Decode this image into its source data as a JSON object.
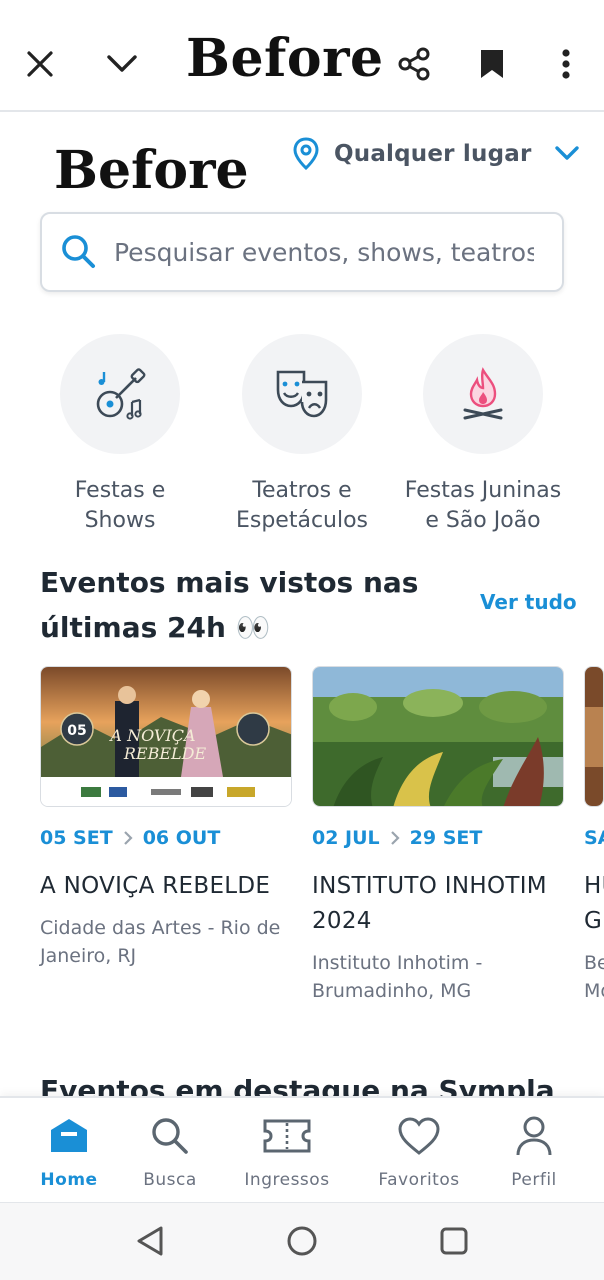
{
  "topbar": {
    "title": "Before"
  },
  "page_heading": "Before",
  "location": {
    "label": "Qualquer lugar"
  },
  "search": {
    "placeholder": "Pesquisar eventos, shows, teatros, festas..."
  },
  "categories": [
    {
      "label_line1": "Festas e",
      "label_line2": "Shows",
      "icon": "guitar-music-icon"
    },
    {
      "label_line1": "Teatros e",
      "label_line2": "Espetáculos",
      "icon": "theater-masks-icon"
    },
    {
      "label_line1": "Festas Juninas",
      "label_line2": "e São João",
      "icon": "bonfire-icon"
    }
  ],
  "section": {
    "title_line1": "Eventos mais vistos nas",
    "title_line2": "últimas 24h 👀",
    "see_all": "Ver tudo"
  },
  "events": [
    {
      "start": "05 SET",
      "end": "06 OUT",
      "title": "A NOVIÇA REBELDE",
      "place": "Cidade das Artes - Rio de Janeiro, RJ",
      "poster_text_1": "A NOVIÇA",
      "poster_text_2": "REBELDE",
      "poster_date": "05"
    },
    {
      "start": "02 JUL",
      "end": "29 SET",
      "title": "INSTITUTO INHOTIM 2024",
      "place": "Instituto Inhotim - Brumadinho, MG"
    },
    {
      "start": "SA",
      "title_line1": "HU",
      "title_line2": "GI",
      "place_line1": "Be",
      "place_line2": "Mo"
    }
  ],
  "next_section": {
    "title": "Eventos em destaque na Sympla"
  },
  "bottom_nav": [
    {
      "label": "Home",
      "active": true
    },
    {
      "label": "Busca"
    },
    {
      "label": "Ingressos"
    },
    {
      "label": "Favoritos"
    },
    {
      "label": "Perfil"
    }
  ],
  "colors": {
    "accent": "#1a8fd6",
    "text": "#1f2933",
    "muted": "#6b7280",
    "fire": "#ec4f7e"
  }
}
